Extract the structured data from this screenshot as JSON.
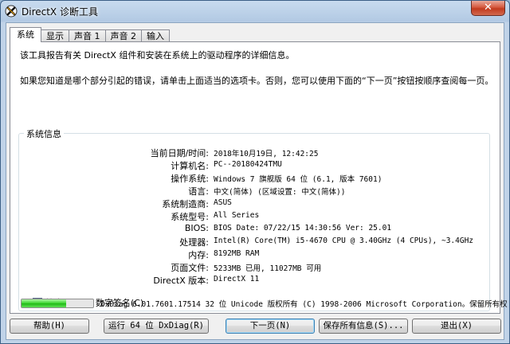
{
  "window": {
    "title": "DirectX 诊断工具",
    "close_label": "✕"
  },
  "tabs": [
    {
      "label": "系统"
    },
    {
      "label": "显示"
    },
    {
      "label": "声音 1"
    },
    {
      "label": "声音 2"
    },
    {
      "label": "输入"
    }
  ],
  "intro": {
    "line1": "该工具报告有关 DirectX 组件和安装在系统上的驱动程序的详细信息。",
    "line2": "如果您知道是哪个部分引起的错误，请单击上面适当的选项卡。否则，您可以使用下面的“下一页”按钮按顺序查阅每一页。"
  },
  "system_info": {
    "title": "系统信息",
    "rows": [
      {
        "label": "当前日期/时间:",
        "value": "2018年10月19日, 12:42:25"
      },
      {
        "label": "计算机名:",
        "value": "PC--20180424TMU"
      },
      {
        "label": "操作系统:",
        "value": "Windows 7 旗舰版 64 位 (6.1, 版本 7601)"
      },
      {
        "label": "语言:",
        "value": "中文(简体) (区域设置: 中文(简体))"
      },
      {
        "label": "系统制造商:",
        "value": "ASUS"
      },
      {
        "label": "系统型号:",
        "value": "All Series"
      },
      {
        "label": "BIOS:",
        "value": "BIOS Date: 07/22/15 14:30:56 Ver: 25.01"
      },
      {
        "label": "处理器:",
        "value": "Intel(R) Core(TM) i5-4670 CPU @ 3.40GHz (4 CPUs), ~3.4GHz"
      },
      {
        "label": "内存:",
        "value": "8192MB RAM"
      },
      {
        "label": "页面文件:",
        "value": "5233MB 已用, 11027MB 可用"
      },
      {
        "label": "DirectX 版本:",
        "value": "DirectX 11"
      }
    ]
  },
  "whql_checkbox": {
    "label": "检查 WHQL 数字签名(C)",
    "checked": true
  },
  "progress": {
    "fraction": 0.62
  },
  "copyright": "DxDiag 6.01.7601.17514 32 位 Unicode 版权所有 (C) 1998-2006 Microsoft Corporation。保留所有权",
  "buttons": {
    "help": "帮助(H)",
    "run64": "运行 64 位 DxDiag(R)",
    "next": "下一页(N)",
    "save_all": "保存所有信息(S)...",
    "exit": "退出(X)"
  },
  "colors": {
    "progress_green": "#37d52c",
    "title_close_red": "#c23a1f"
  }
}
